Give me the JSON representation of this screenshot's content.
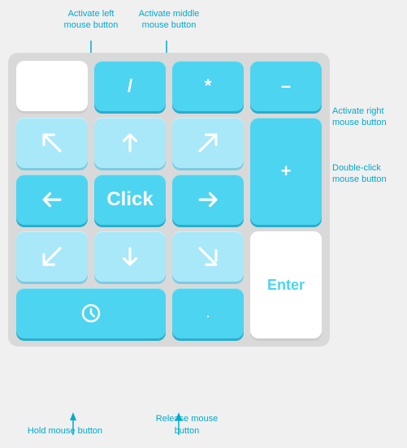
{
  "labels": {
    "activate_left": "Activate left\nmouse button",
    "activate_middle": "Activate middle\nmouse button",
    "activate_right": "Activate right\nmouse button",
    "double_click": "Double-click\nmouse button",
    "hold": "Hold mouse button",
    "release": "Release mouse button"
  },
  "keys": {
    "slash": "/",
    "asterisk": "*",
    "minus": "–",
    "plus": "+",
    "enter": "Enter",
    "click": "Click",
    "dot": "."
  }
}
